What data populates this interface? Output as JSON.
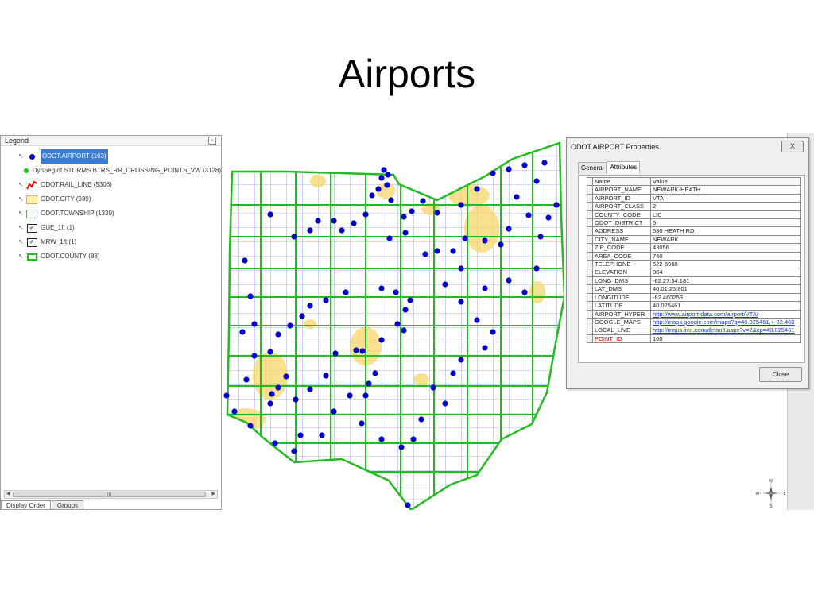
{
  "slide": {
    "title": "Airports"
  },
  "legend": {
    "header": "Legend",
    "items": [
      {
        "label": "ODOT.AIRPORT (163)",
        "symbol": "blue-dot",
        "selected": true
      },
      {
        "label": "DynSeg of STORMS.BTRS_RR_CROSSING_POINTS_VW (3128)",
        "symbol": "green-dot"
      },
      {
        "label": "ODOT.RAIL_LINE (5306)",
        "symbol": "red-line"
      },
      {
        "label": "ODOT.CITY (939)",
        "symbol": "yellow-polygon"
      },
      {
        "label": "ODOT.TOWNSHIP (1330)",
        "symbol": "blue-polygon"
      },
      {
        "label": "GUE_1ft (1)",
        "symbol": "raster"
      },
      {
        "label": "MRW_1ft (1)",
        "symbol": "raster"
      },
      {
        "label": "ODOT.COUNTY (88)",
        "symbol": "green-polygon"
      }
    ],
    "scroll_grip": "III",
    "tabs": [
      "Display Order",
      "Groups"
    ]
  },
  "dialog": {
    "title": "ODOT.AIRPORT Properties",
    "close_x": "X",
    "tabs": [
      "General",
      "Attributes"
    ],
    "active_tab": "Attributes",
    "columns": [
      "Name",
      "Value"
    ],
    "rows": [
      {
        "name": "AIRPORT_NAME",
        "value": "NEWARK-HEATH"
      },
      {
        "name": "AIRPORT_ID",
        "value": "VTA"
      },
      {
        "name": "AIRPORT_CLASS",
        "value": "2"
      },
      {
        "name": "COUNTY_CODE",
        "value": "LIC"
      },
      {
        "name": "ODOT_DISTRICT",
        "value": "5"
      },
      {
        "name": "ADDRESS",
        "value": "530 HEATH RD"
      },
      {
        "name": "CITY_NAME",
        "value": "NEWARK"
      },
      {
        "name": "ZIP_CODE",
        "value": "43056"
      },
      {
        "name": "AREA_CODE",
        "value": "740"
      },
      {
        "name": "TELEPHONE",
        "value": "522-6968"
      },
      {
        "name": "ELEVATION",
        "value": "884"
      },
      {
        "name": "LONG_DMS",
        "value": "-82:27:54.181"
      },
      {
        "name": "LAT_DMS",
        "value": "40:01:25.801"
      },
      {
        "name": "LONGITUDE",
        "value": "-82.460253"
      },
      {
        "name": "LATITUDE",
        "value": "40.025461"
      },
      {
        "name": "AIRPORT_HYPER",
        "value": "http://www.airport-data.com/airport/VTA/",
        "link": true
      },
      {
        "name": "GOOGLE_MAPS",
        "value": "http://maps.google.com/maps?q=40.025461,+-82.460",
        "link": true
      },
      {
        "name": "LOCAL_LIVE",
        "value": "http://maps.live.com/default.aspx?v=2&cp=40.025461",
        "link": true
      },
      {
        "name": "POINT_ID",
        "value": "100",
        "highlight": true
      }
    ],
    "close_button": "Close"
  },
  "compass": {
    "n": "N",
    "s": "S",
    "e": "E",
    "w": "W"
  },
  "colors": {
    "airport": "#0000cc",
    "county": "#22bb22",
    "township": "#6c7cc4",
    "city": "#f7d56a",
    "selection": "#3a7bd5",
    "point_id": "#d00000"
  }
}
